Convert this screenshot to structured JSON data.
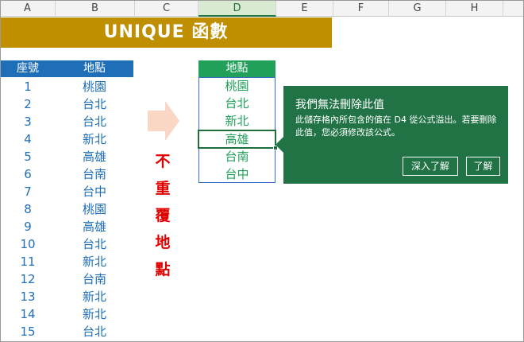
{
  "columns": [
    "A",
    "B",
    "C",
    "D",
    "E",
    "F",
    "G",
    "H"
  ],
  "active_column": "D",
  "title": "UNIQUE 函數",
  "source_table": {
    "headers": [
      "座號",
      "地點"
    ],
    "rows": [
      [
        "1",
        "桃園"
      ],
      [
        "2",
        "台北"
      ],
      [
        "3",
        "台北"
      ],
      [
        "4",
        "新北"
      ],
      [
        "5",
        "高雄"
      ],
      [
        "6",
        "台南"
      ],
      [
        "7",
        "台中"
      ],
      [
        "8",
        "桃園"
      ],
      [
        "9",
        "高雄"
      ],
      [
        "10",
        "台北"
      ],
      [
        "11",
        "新北"
      ],
      [
        "12",
        "台南"
      ],
      [
        "13",
        "新北"
      ],
      [
        "14",
        "新北"
      ],
      [
        "15",
        "台北"
      ]
    ]
  },
  "vertical_label": [
    "不",
    "重",
    "覆",
    "地",
    "點"
  ],
  "result": {
    "header": "地點",
    "values": [
      "桃園",
      "台北",
      "新北",
      "高雄",
      "台南",
      "台中"
    ],
    "selected_value": "高雄"
  },
  "popup": {
    "title": "我們無法刪除此值",
    "message": "此儲存格內所包含的值在 D4 從公式溢出。若要刪除此值，您必須修改該公式。",
    "learn_more_button": "深入了解",
    "ok_button": "了解"
  },
  "colors": {
    "banner": "#bf8f00",
    "source_header": "#1f6fb8",
    "result_header": "#21a05a",
    "popup": "#217346",
    "label_red": "#e00000"
  }
}
